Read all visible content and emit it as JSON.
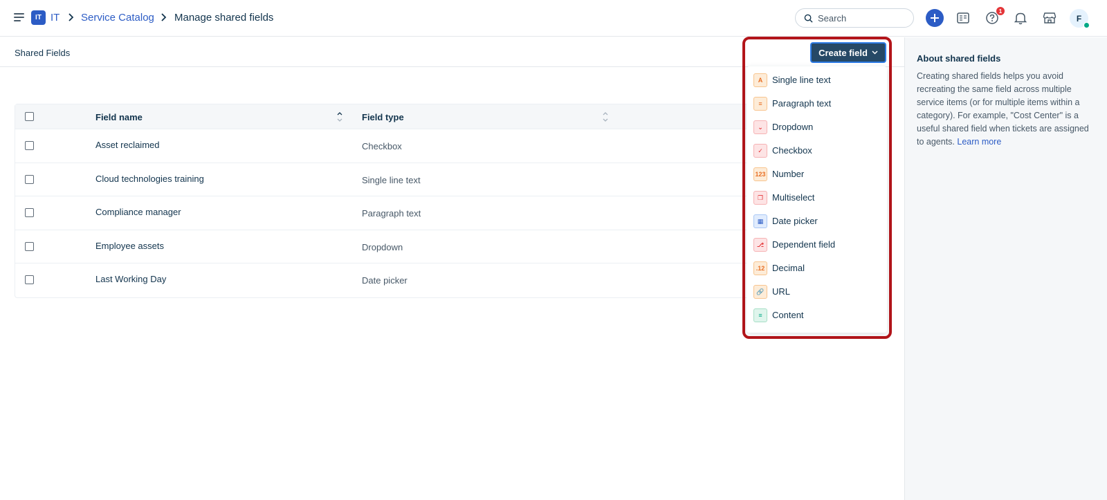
{
  "header": {
    "workspace_badge": "IT",
    "breadcrumb": [
      {
        "label": "IT"
      },
      {
        "label": "Service Catalog"
      },
      {
        "label": "Manage shared fields"
      }
    ],
    "search_placeholder": "Search",
    "help_badge_count": "1",
    "avatar_initial": "F"
  },
  "subheader": {
    "title": "Shared Fields"
  },
  "table": {
    "columns": [
      "Field name",
      "Field type"
    ],
    "rows": [
      {
        "name": "Asset reclaimed",
        "type": "Checkbox"
      },
      {
        "name": "Cloud technologies training",
        "type": "Single line text"
      },
      {
        "name": "Compliance manager",
        "type": "Paragraph text"
      },
      {
        "name": "Employee assets",
        "type": "Dropdown"
      },
      {
        "name": "Last Working Day",
        "type": "Date picker"
      }
    ]
  },
  "create_field": {
    "button_label": "Create field",
    "items": [
      {
        "label": "Single line text",
        "icon": "text-a-icon",
        "color": "orange",
        "glyph": "A"
      },
      {
        "label": "Paragraph text",
        "icon": "paragraph-icon",
        "color": "orange",
        "glyph": "≡"
      },
      {
        "label": "Dropdown",
        "icon": "dropdown-icon",
        "color": "red",
        "glyph": "⌄"
      },
      {
        "label": "Checkbox",
        "icon": "checkbox-icon",
        "color": "red",
        "glyph": "✓"
      },
      {
        "label": "Number",
        "icon": "number-icon",
        "color": "orange",
        "glyph": "123"
      },
      {
        "label": "Multiselect",
        "icon": "multiselect-icon",
        "color": "red",
        "glyph": "❐"
      },
      {
        "label": "Date picker",
        "icon": "calendar-icon",
        "color": "blue",
        "glyph": "▦"
      },
      {
        "label": "Dependent field",
        "icon": "dependent-field-icon",
        "color": "red",
        "glyph": "⎇"
      },
      {
        "label": "Decimal",
        "icon": "decimal-icon",
        "color": "orange",
        "glyph": ".12"
      },
      {
        "label": "URL",
        "icon": "link-icon",
        "color": "orange",
        "glyph": "🔗"
      },
      {
        "label": "Content",
        "icon": "content-icon",
        "color": "green",
        "glyph": "≡"
      }
    ]
  },
  "about_panel": {
    "title": "About shared fields",
    "body": "Creating shared fields helps you avoid recreating the same field across multiple service items (or for multiple items within a category). For example, \"Cost Center\" is a useful shared field when tickets are assigned to agents. ",
    "link_label": "Learn more"
  },
  "colors": {
    "brand_blue": "#2c5cc5",
    "button_dark": "#264966",
    "highlight_red": "#b3151a",
    "presence_green": "#00a886"
  }
}
